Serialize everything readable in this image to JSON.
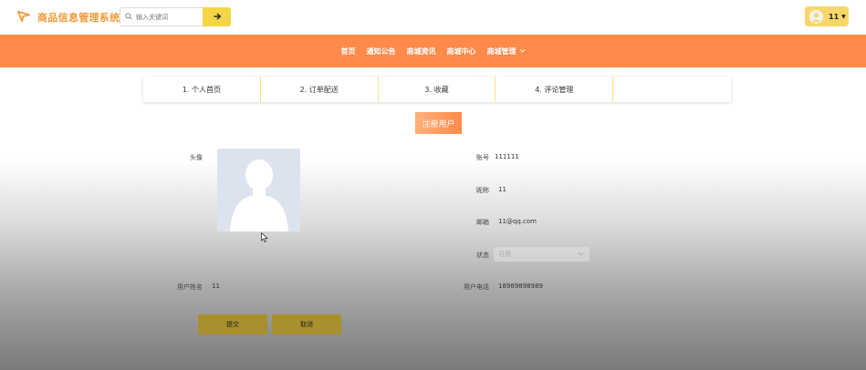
{
  "header": {
    "app_title": "商品信息管理系统",
    "search_placeholder": "输入关键词",
    "user_name": "11"
  },
  "nav": {
    "items": [
      "首页",
      "通知公告",
      "商城资讯",
      "商城中心",
      "商城管理"
    ]
  },
  "tabs": [
    "1. 个人首页",
    "2. 订单配送",
    "3. 收藏",
    "4. 评论管理",
    ""
  ],
  "register_button": "注册用户",
  "form": {
    "avatar_label": "头像",
    "account_label": "账号",
    "account_value": "111111",
    "nickname_label": "昵称",
    "nickname_value": "11",
    "email_label": "邮箱",
    "email_value": "11@qq.com",
    "status_label": "状态",
    "status_value": "可用",
    "realname_label": "用户姓名",
    "realname_value": "11",
    "phone_label": "用户电话",
    "phone_value": "18989898989"
  },
  "buttons": {
    "submit": "提交",
    "cancel": "取消"
  },
  "colors": {
    "brand_orange": "#ff8a4a",
    "accent_yellow": "#f3d547",
    "logo_orange": "#f29b3a",
    "action_button": "#a8902c"
  },
  "icons": {
    "logo": "send-icon",
    "search": "search-icon",
    "search_button": "arrow-right-icon",
    "nav_dropdown": "chevron-down-icon",
    "status_dropdown": "chevron-down-icon"
  }
}
